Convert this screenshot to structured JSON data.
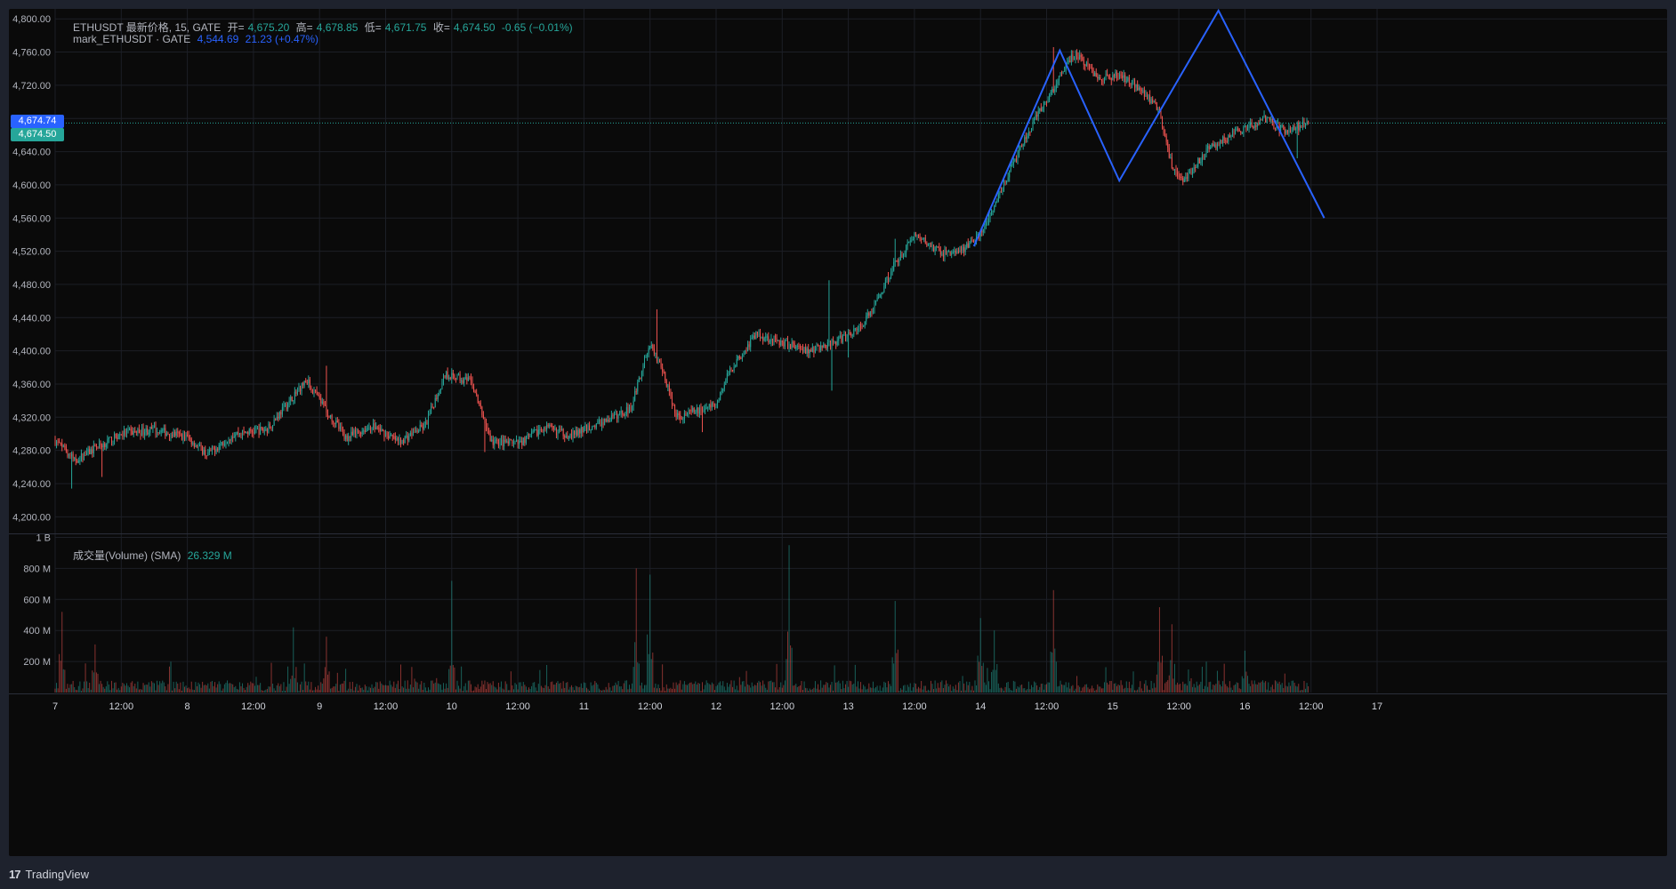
{
  "legend_main": {
    "symbol": "ETHUSDT 最新价格, 15, GATE",
    "open_label": "开=",
    "open": "4,675.20",
    "high_label": "高=",
    "high": "4,678.85",
    "low_label": "低=",
    "low": "4,671.75",
    "close_label": "收=",
    "close": "4,674.50",
    "change": "-0.65 (−0.01%)"
  },
  "legend_mark": {
    "symbol": "mark_ETHUSDT · GATE",
    "value": "4,544.69",
    "change": "21.23 (+0.47%)"
  },
  "legend_volume": {
    "label": "成交量(Volume) (SMA)",
    "value": "26.329 M"
  },
  "price_badges": {
    "mark": "4,674.74",
    "last": "4,674.50"
  },
  "footer": {
    "logo": "17",
    "brand": "TradingView"
  },
  "colors": {
    "up": "#26a69a",
    "down": "#ef5350",
    "pattern_line": "#2962ff",
    "last_price": "#26a69a",
    "mark_price": "#2962ff",
    "background": "#0a0a0a",
    "grid": "#1c1f26"
  },
  "chart_data": [
    {
      "type": "candlestick",
      "interval": "15",
      "x_tick_labels": [
        "7",
        "12:00",
        "8",
        "12:00",
        "9",
        "12:00",
        "10",
        "12:00",
        "11",
        "12:00",
        "12",
        "12:00",
        "13",
        "12:00",
        "14",
        "12:00",
        "15",
        "12:00",
        "16",
        "12:00",
        "17"
      ],
      "y_tick_labels": [
        "4,800.00",
        "4,760.00",
        "4,720.00",
        "4,680.00",
        "4,640.00",
        "4,600.00",
        "4,560.00",
        "4,520.00",
        "4,480.00",
        "4,440.00",
        "4,400.00",
        "4,360.00",
        "4,320.00",
        "4,280.00",
        "4,240.00",
        "4,200.00"
      ],
      "ylim": [
        4180,
        4812
      ],
      "xlim_days": [
        7,
        17
      ],
      "last_price": 4674.5,
      "mark_price": 4674.74,
      "close_path": [
        [
          7.0,
          4292
        ],
        [
          7.15,
          4268
        ],
        [
          7.3,
          4282
        ],
        [
          7.5,
          4300
        ],
        [
          7.75,
          4305
        ],
        [
          8.0,
          4296
        ],
        [
          8.15,
          4275
        ],
        [
          8.35,
          4300
        ],
        [
          8.6,
          4305
        ],
        [
          8.8,
          4345
        ],
        [
          8.9,
          4365
        ],
        [
          9.0,
          4340
        ],
        [
          9.2,
          4295
        ],
        [
          9.4,
          4310
        ],
        [
          9.6,
          4290
        ],
        [
          9.8,
          4310
        ],
        [
          9.95,
          4372
        ],
        [
          10.15,
          4362
        ],
        [
          10.3,
          4290
        ],
        [
          10.5,
          4288
        ],
        [
          10.7,
          4308
        ],
        [
          10.9,
          4298
        ],
        [
          11.2,
          4318
        ],
        [
          11.35,
          4330
        ],
        [
          11.5,
          4410
        ],
        [
          11.6,
          4375
        ],
        [
          11.7,
          4320
        ],
        [
          12.0,
          4335
        ],
        [
          12.1,
          4375
        ],
        [
          12.3,
          4420
        ],
        [
          12.5,
          4410
        ],
        [
          12.7,
          4400
        ],
        [
          12.9,
          4410
        ],
        [
          13.1,
          4430
        ],
        [
          13.2,
          4455
        ],
        [
          13.35,
          4505
        ],
        [
          13.5,
          4540
        ],
        [
          13.7,
          4518
        ],
        [
          13.85,
          4520
        ],
        [
          14.0,
          4540
        ],
        [
          14.2,
          4610
        ],
        [
          14.4,
          4675
        ],
        [
          14.55,
          4715
        ],
        [
          14.65,
          4745
        ],
        [
          14.72,
          4758
        ],
        [
          14.9,
          4728
        ],
        [
          15.05,
          4732
        ],
        [
          15.2,
          4718
        ],
        [
          15.35,
          4690
        ],
        [
          15.45,
          4620
        ],
        [
          15.55,
          4605
        ],
        [
          15.7,
          4640
        ],
        [
          15.9,
          4660
        ],
        [
          16.0,
          4668
        ],
        [
          16.15,
          4680
        ],
        [
          16.3,
          4665
        ],
        [
          16.48,
          4674.5
        ]
      ],
      "spikes": [
        [
          7.12,
          4234
        ],
        [
          7.35,
          4248
        ],
        [
          9.05,
          4382
        ],
        [
          10.25,
          4278
        ],
        [
          11.55,
          4450
        ],
        [
          11.9,
          4302
        ],
        [
          12.85,
          4485
        ],
        [
          12.88,
          4352
        ],
        [
          13.0,
          4392
        ],
        [
          13.35,
          4535
        ],
        [
          14.55,
          4766
        ],
        [
          16.4,
          4632
        ]
      ],
      "pattern_line": [
        [
          13.95,
          4526
        ],
        [
          14.6,
          4762
        ],
        [
          15.05,
          4605
        ],
        [
          15.8,
          4810
        ],
        [
          16.6,
          4560
        ]
      ],
      "volume": {
        "y_tick_labels": [
          "1 B",
          "800 M",
          "600 M",
          "400 M",
          "200 M"
        ],
        "ylim": [
          0,
          1020
        ],
        "unit": "M",
        "baseline": 26.329,
        "spikes": [
          [
            7.05,
            520
          ],
          [
            7.3,
            310
          ],
          [
            8.8,
            420
          ],
          [
            9.05,
            360
          ],
          [
            10.0,
            720
          ],
          [
            11.4,
            800
          ],
          [
            11.5,
            760
          ],
          [
            12.55,
            950
          ],
          [
            13.35,
            590
          ],
          [
            14.0,
            480
          ],
          [
            14.1,
            400
          ],
          [
            14.55,
            660
          ],
          [
            15.35,
            550
          ],
          [
            15.45,
            440
          ],
          [
            16.0,
            270
          ]
        ]
      }
    }
  ]
}
